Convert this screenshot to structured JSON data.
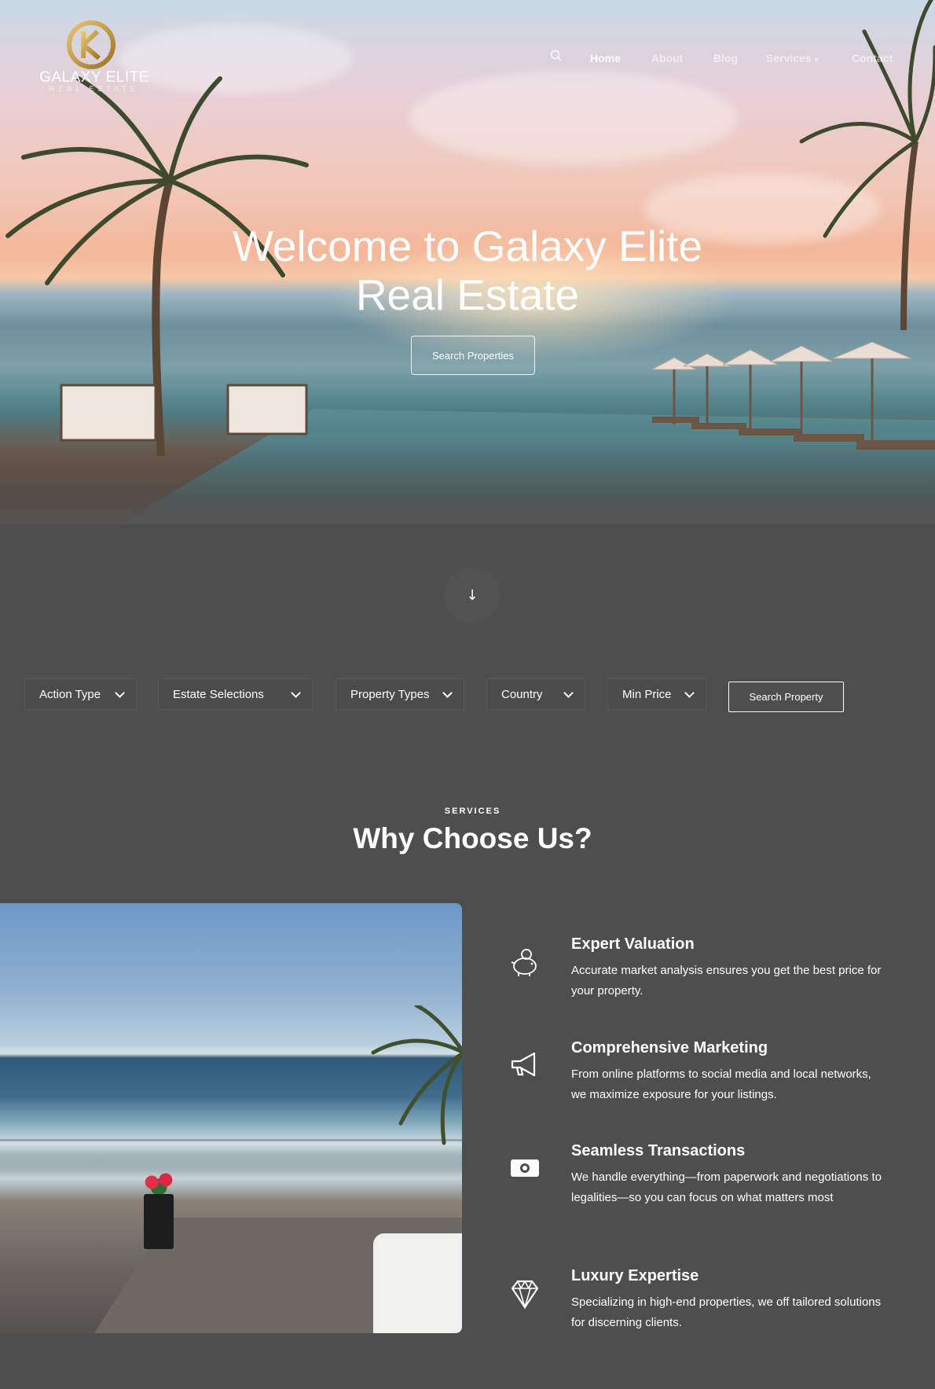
{
  "brand": {
    "name": "GALAXY ELITE",
    "sub": "REAL ESTATE"
  },
  "nav": {
    "search_icon": "search-icon",
    "items": [
      {
        "label": "Home"
      },
      {
        "label": "About"
      },
      {
        "label": "Blog"
      },
      {
        "label": "Services"
      },
      {
        "label": "Contact"
      }
    ]
  },
  "hero": {
    "title_line1": "Welcome to Galaxy Elite",
    "title_line2": "Real Estate",
    "cta": "Search Properties",
    "scroll_icon": "↓"
  },
  "filters": {
    "items": [
      {
        "label": "Action Type"
      },
      {
        "label": "Estate Selections"
      },
      {
        "label": "Property Types"
      },
      {
        "label": "Country"
      },
      {
        "label": "Min Price"
      }
    ],
    "submit": "Search Property"
  },
  "services": {
    "eyebrow": "SERVICES",
    "title": "Why Choose Us?",
    "features": [
      {
        "icon": "piggy-bank-icon",
        "title": "Expert Valuation",
        "text": "Accurate market analysis ensures you get the best price for your property."
      },
      {
        "icon": "megaphone-icon",
        "title": "Comprehensive Marketing",
        "text": "From online platforms to social media and local networks, we maximize exposure for your listings."
      },
      {
        "icon": "cash-icon",
        "title": "Seamless Transactions",
        "text": "We handle everything—from paperwork and negotiations to legalities—so you can focus on what matters most"
      },
      {
        "icon": "diamond-icon",
        "title": "Luxury Expertise",
        "text": "Specializing in high-end properties, we off tailored solutions for discerning clients."
      }
    ]
  },
  "colors": {
    "background": "#4e4e4e",
    "logo_gold": "#c9a14a"
  }
}
